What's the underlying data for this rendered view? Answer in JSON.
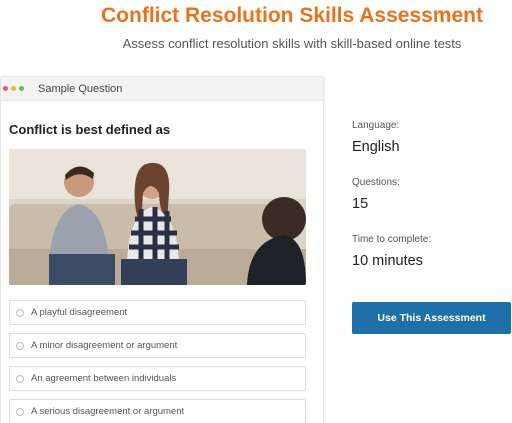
{
  "header": {
    "title": "Conflict Resolution Skills Assessment",
    "subtitle": "Assess conflict resolution skills with skill-based online tests"
  },
  "card": {
    "header_label": "Sample Question",
    "window_dot_colors": [
      "#f05a5a",
      "#f5b931",
      "#58c254"
    ],
    "question": "Conflict is best defined as",
    "image_description": "",
    "options": [
      "A playful disagreement",
      "A minor disagreement or argument",
      "An agreement between individuals",
      "A serious disagreement or argument"
    ]
  },
  "info": {
    "language_label": "Language:",
    "language_value": "English",
    "questions_label": "Questions:",
    "questions_value": "15",
    "time_label": "Time to complete:",
    "time_value": "10 minutes"
  },
  "cta": {
    "label": "Use This Assessment",
    "color": "#1f6fa8"
  },
  "accent_color": "#e8731c"
}
